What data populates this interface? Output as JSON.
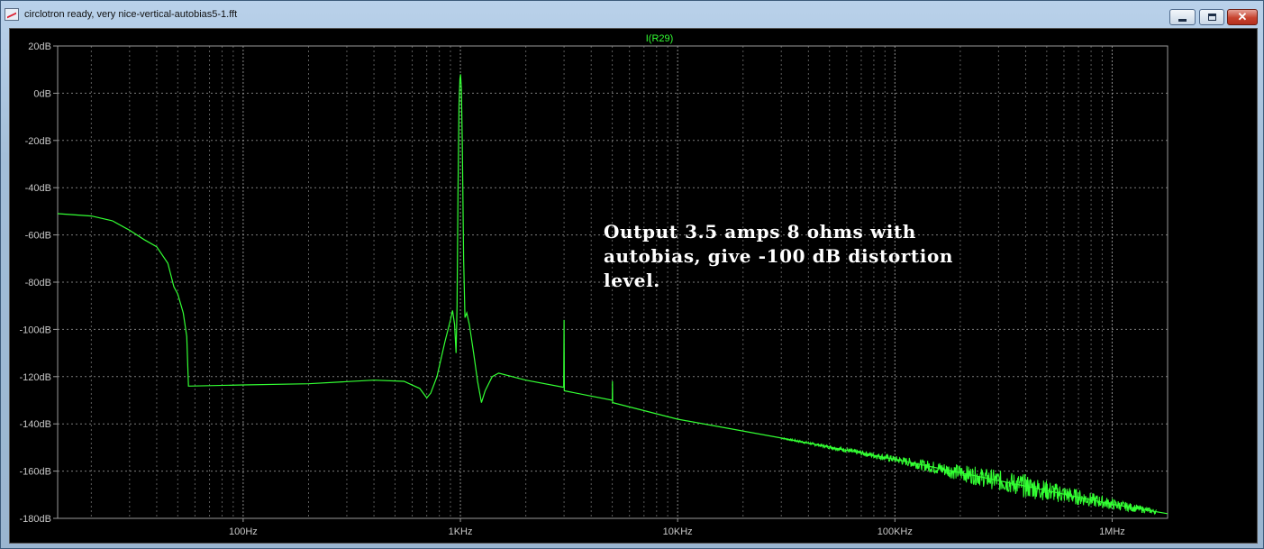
{
  "window": {
    "title": "circlotron ready, very nice-vertical-autobias5-1.fft",
    "icon": "waveform-icon",
    "buttons": {
      "minimize": "minimize-icon",
      "maximize": "maximize-icon",
      "close": "✕"
    }
  },
  "colors": {
    "background": "#000000",
    "grid": "#9a9a9a",
    "trace": "#33ff33",
    "axis_text": "#c8c8c8",
    "annotation": "#ffffff"
  },
  "chart_data": {
    "type": "line",
    "title": "I(R29)",
    "xscale": "log",
    "xlim": [
      14,
      1800000
    ],
    "ylim": [
      -180,
      20
    ],
    "grid": "on",
    "x_ticks": [
      {
        "v": 100,
        "label": "100Hz"
      },
      {
        "v": 1000,
        "label": "1KHz"
      },
      {
        "v": 10000,
        "label": "10KHz"
      },
      {
        "v": 100000,
        "label": "100KHz"
      },
      {
        "v": 1000000,
        "label": "1MHz"
      }
    ],
    "y_ticks": [
      {
        "v": 20,
        "label": "20dB"
      },
      {
        "v": 0,
        "label": "0dB"
      },
      {
        "v": -20,
        "label": "-20dB"
      },
      {
        "v": -40,
        "label": "-40dB"
      },
      {
        "v": -60,
        "label": "-60dB"
      },
      {
        "v": -80,
        "label": "-80dB"
      },
      {
        "v": -100,
        "label": "-100dB"
      },
      {
        "v": -120,
        "label": "-120dB"
      },
      {
        "v": -140,
        "label": "-140dB"
      },
      {
        "v": -160,
        "label": "-160dB"
      },
      {
        "v": -180,
        "label": "-180dB"
      }
    ],
    "series": [
      {
        "name": "I(R29)",
        "points": [
          [
            14,
            -51
          ],
          [
            20,
            -52
          ],
          [
            25,
            -54
          ],
          [
            30,
            -58
          ],
          [
            35,
            -62
          ],
          [
            40,
            -65
          ],
          [
            45,
            -72
          ],
          [
            48,
            -82
          ],
          [
            50,
            -85
          ],
          [
            53,
            -93
          ],
          [
            55,
            -103
          ],
          [
            56,
            -124
          ],
          [
            100,
            -123.5
          ],
          [
            200,
            -123
          ],
          [
            400,
            -121.5
          ],
          [
            550,
            -122
          ],
          [
            650,
            -125
          ],
          [
            700,
            -129
          ],
          [
            730,
            -127
          ],
          [
            780,
            -120
          ],
          [
            850,
            -105
          ],
          [
            900,
            -96
          ],
          [
            920,
            -92
          ],
          [
            940,
            -98
          ],
          [
            955,
            -110
          ],
          [
            965,
            -90
          ],
          [
            975,
            -40
          ],
          [
            985,
            -5
          ],
          [
            995,
            6
          ],
          [
            1002,
            8
          ],
          [
            1010,
            2
          ],
          [
            1020,
            -20
          ],
          [
            1035,
            -70
          ],
          [
            1050,
            -95
          ],
          [
            1070,
            -93
          ],
          [
            1100,
            -98
          ],
          [
            1150,
            -110
          ],
          [
            1200,
            -122
          ],
          [
            1250,
            -131
          ],
          [
            1300,
            -126
          ],
          [
            1400,
            -120
          ],
          [
            1500,
            -118.5
          ],
          [
            2000,
            -121.5
          ],
          [
            2990,
            -124.5
          ],
          [
            3000,
            -96
          ],
          [
            3010,
            -126
          ],
          [
            5000,
            -130
          ],
          [
            5010,
            -122
          ],
          [
            5020,
            -131
          ],
          [
            10000,
            -138
          ],
          [
            30000,
            -146
          ],
          [
            100000,
            -155
          ],
          [
            300000,
            -164
          ],
          [
            1000000,
            -174
          ],
          [
            1800000,
            -178
          ]
        ],
        "noise_band": [
          [
            30000,
            0.3
          ],
          [
            100000,
            1.5
          ],
          [
            200000,
            3.5
          ],
          [
            400000,
            5
          ],
          [
            800000,
            3
          ],
          [
            1600000,
            1
          ]
        ]
      }
    ],
    "annotations": [
      {
        "lines": [
          "Output 3.5 amps 8 ohms with",
          "autobias, give -100 dB distortion",
          "level."
        ]
      }
    ]
  }
}
